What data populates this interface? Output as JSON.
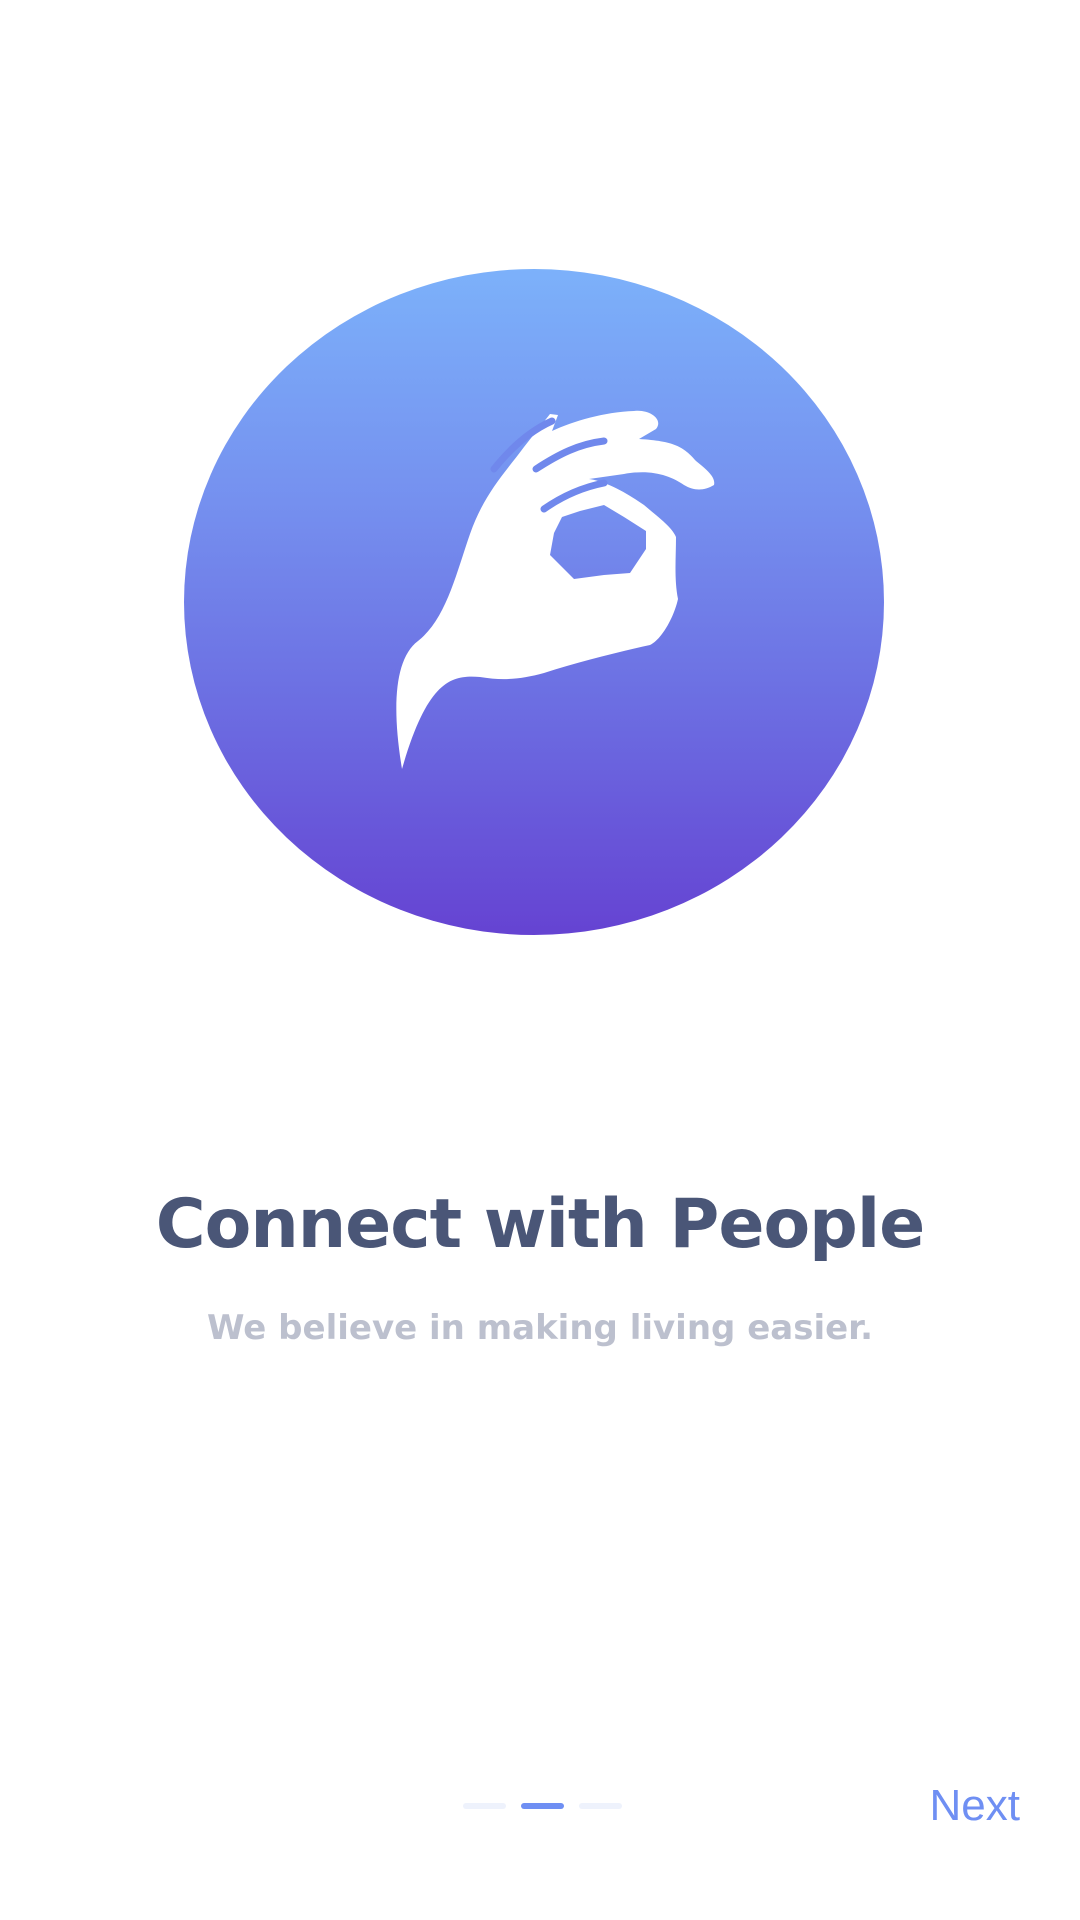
{
  "onboarding": {
    "hero_icon": "ok-hand-gesture-icon",
    "title": "Connect with People",
    "subtitle": "We believe in making living easier.",
    "next_label": "Next",
    "pager": {
      "total": 3,
      "current": 2
    }
  },
  "colors": {
    "gradient_top": "#7cb1fa",
    "gradient_bottom": "#6543d2",
    "title": "#4a5677",
    "subtitle": "#bcc0ce",
    "accent": "#6f8ff3",
    "inactive_dot": "#eef2fc"
  }
}
